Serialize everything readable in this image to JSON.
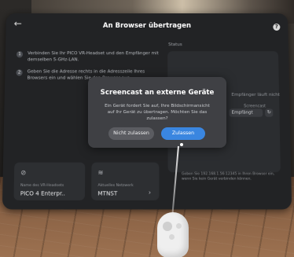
{
  "panel": {
    "title": "An Browser übertragen",
    "back_icon": "back-arrow-icon",
    "help_icon": "help-icon"
  },
  "steps": [
    {
      "num": "1",
      "text": "Verbinden Sie Ihr PICO VR-Headset und den Empfänger mit demselben 5-GHz-LAN."
    },
    {
      "num": "2",
      "text": "Geben Sie die Adresse rechts in die Adresszeile Ihres Browsers ein und wählen Sie den Browser aus."
    }
  ],
  "status": {
    "label": "Status",
    "text": "Empfänger läuft nicht",
    "sub": "Screencast",
    "select_value": "Empfängt",
    "note": "Geben Sie 192.168.1.56:12345 in Ihren Browser ein, wenn Sie kein Gerät verbinden können."
  },
  "cards": [
    {
      "icon": "headset-icon",
      "label": "Name des VR-Headsets",
      "value": "PICO 4 Enterpr.."
    },
    {
      "icon": "wifi-icon",
      "label": "Aktuelles Netzwerk",
      "value": "MTNST"
    }
  ],
  "dialog": {
    "title": "Screencast an externe Geräte",
    "message": "Ein Gerät fordert Sie auf, Ihre Bildschirmansicht auf Ihr Gerät zu übertragen. Möchten Sie das zulassen?",
    "deny_label": "Nicht zulassen",
    "allow_label": "Zulassen"
  },
  "colors": {
    "accent": "#3a86e0",
    "panel_bg": "#222325",
    "dialog_bg": "#3f4044"
  }
}
